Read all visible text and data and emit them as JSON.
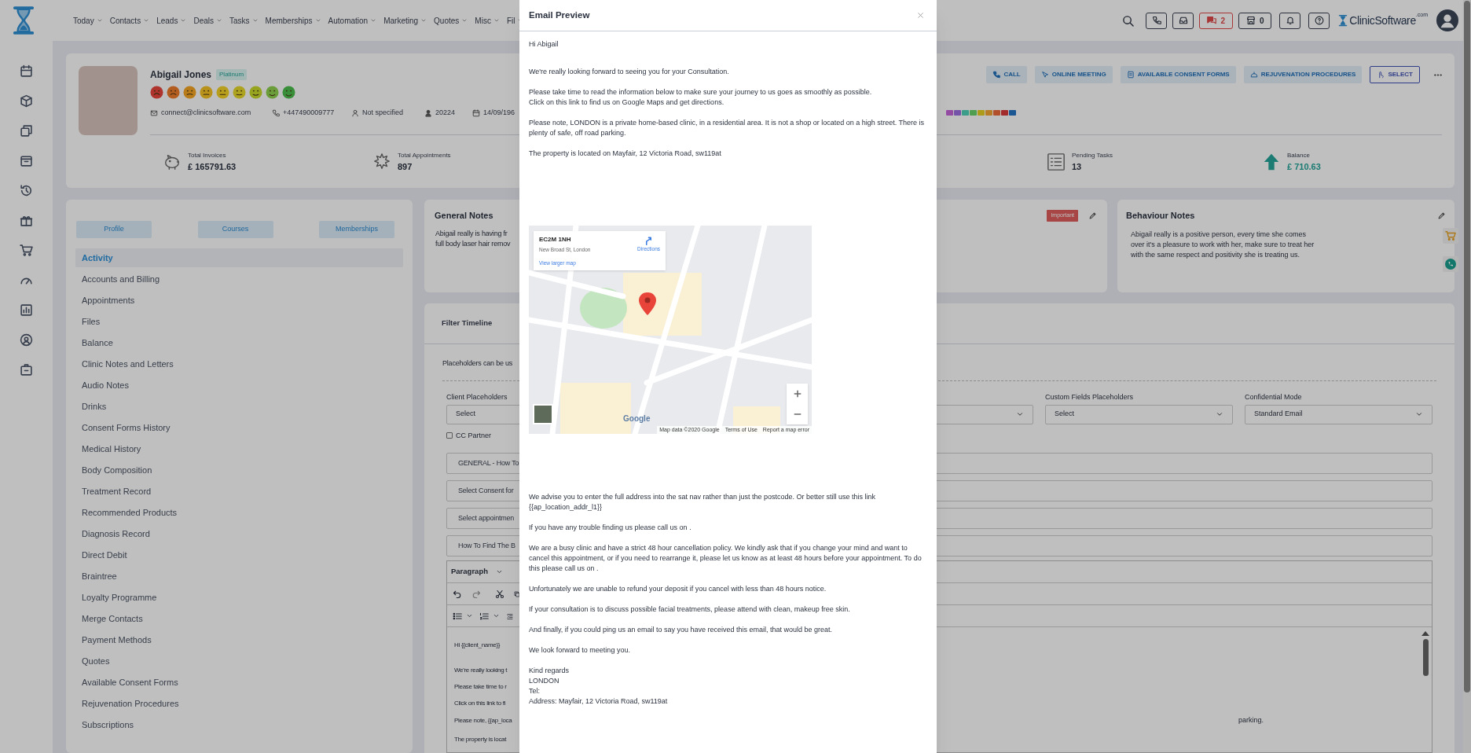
{
  "nav": {
    "items": [
      "Today",
      "Contacts",
      "Leads",
      "Deals",
      "Tasks",
      "Memberships",
      "Automation",
      "Marketing",
      "Quotes",
      "Misc",
      "Fil"
    ],
    "chat_count": "2",
    "store_count": "0",
    "brand": "ClinicSoftware",
    "brand_suffix": ".com"
  },
  "profile": {
    "name": "Abigail Jones",
    "tier": "Platinum",
    "ratings": [
      {
        "color": "#ae342d"
      },
      {
        "color": "#b45d20"
      },
      {
        "color": "#b87d1a"
      },
      {
        "color": "#b9921c"
      },
      {
        "color": "#b89e1d"
      },
      {
        "color": "#aea320"
      },
      {
        "color": "#97a420"
      },
      {
        "color": "#6b9d3b"
      },
      {
        "color": "#398f39"
      }
    ],
    "email": "connect@clinicsoftware.com",
    "phone": "+447490009777",
    "gender": "Not specified",
    "client_id": "20224",
    "birth_date": "14/09/196",
    "tags": [
      {
        "color": "#944ba2"
      },
      {
        "color": "#7453a8"
      },
      {
        "color": "#3b9d8a"
      },
      {
        "color": "#509e50"
      },
      {
        "color": "#af9b1a"
      },
      {
        "color": "#b67c26"
      },
      {
        "color": "#b3502c"
      },
      {
        "color": "#a22c2c"
      },
      {
        "color": "#1b5793"
      }
    ],
    "actions": [
      {
        "label": "CALL",
        "kind": "call"
      },
      {
        "label": "ONLINE MEETING",
        "kind": "meeting"
      },
      {
        "label": "AVAILABLE CONSENT FORMS",
        "kind": "forms"
      },
      {
        "label": "REJUVENATION PROCEDURES",
        "kind": "procedures"
      },
      {
        "label": "SELECT",
        "kind": "select"
      }
    ]
  },
  "stats": [
    {
      "kind": "invoices",
      "label": "Total Invoices",
      "value": "£ 165791.63"
    },
    {
      "kind": "appointments",
      "label": "Total Appointments",
      "value": "897"
    },
    {
      "kind": "tasks",
      "label": "Pending Tasks",
      "value": "13"
    },
    {
      "kind": "balance",
      "label": "Balance",
      "value": "£ 710.63"
    }
  ],
  "side_tabs": [
    "Profile",
    "Courses",
    "Memberships"
  ],
  "menu": [
    {
      "label": "Activity",
      "selected": true
    },
    {
      "label": "Accounts and Billing",
      "selected": false
    },
    {
      "label": "Appointments",
      "selected": false
    },
    {
      "label": "Files",
      "selected": false
    },
    {
      "label": "Balance",
      "selected": false
    },
    {
      "label": "Clinic Notes and Letters",
      "selected": false
    },
    {
      "label": "Audio Notes",
      "selected": false
    },
    {
      "label": "Drinks",
      "selected": false
    },
    {
      "label": "Consent Forms History",
      "selected": false
    },
    {
      "label": "Medical History",
      "selected": false
    },
    {
      "label": "Body Composition",
      "selected": false
    },
    {
      "label": "Treatment Record",
      "selected": false
    },
    {
      "label": "Recommended Products",
      "selected": false
    },
    {
      "label": "Diagnosis Record",
      "selected": false
    },
    {
      "label": "Direct Debit",
      "selected": false
    },
    {
      "label": "Braintree",
      "selected": false
    },
    {
      "label": "Loyalty Programme",
      "selected": false
    },
    {
      "label": "Merge Contacts",
      "selected": false
    },
    {
      "label": "Payment Methods",
      "selected": false
    },
    {
      "label": "Quotes",
      "selected": false
    },
    {
      "label": "Available Consent Forms",
      "selected": false
    },
    {
      "label": "Rejuvenation Procedures",
      "selected": false
    },
    {
      "label": "Subscriptions",
      "selected": false
    }
  ],
  "general_notes": {
    "title": "General Notes",
    "lines": [
      "Abigail really is having fr",
      "full body laser hair remov"
    ],
    "badge": "Important"
  },
  "behaviour_notes": {
    "title": "Behaviour Notes",
    "text": "Abigail really is a positive person, every time she comes over it's a pleasure to work with her, make sure to treat her with the same respect and positivity she is treating us."
  },
  "timeline": {
    "tab": "Filter Timeline",
    "hint": "Placeholders can be us",
    "selects": [
      {
        "label": "Client Placeholders",
        "value": "Select"
      },
      {
        "label": "Custom Fields Placeholders",
        "value": "Select"
      },
      {
        "label": "Confidential Mode",
        "value": "Standard Email"
      }
    ],
    "cc_partner": {
      "label": "CC Partner",
      "checked": false
    },
    "fields": [
      "GENERAL - How To",
      "Select Consent for",
      "Select appointmen",
      "How To Find The B"
    ],
    "editor": {
      "format": "Paragraph",
      "lines": [
        {
          "text": "Hi {{client_name}}"
        },
        {
          "text": "We're really looking t"
        },
        {
          "text": "Please take time to r"
        },
        {
          "text": "Click on this link to fi"
        },
        {
          "text": "Please note, {{ap_loca",
          "tail": "parking."
        },
        {
          "text": "The property is locat"
        }
      ]
    }
  },
  "modal": {
    "title": "Email Preview",
    "body": [
      {
        "kind": "text",
        "lines": [
          "Hi Abigail"
        ]
      },
      {
        "kind": "text",
        "lines": [
          "We're really looking forward to seeing you for your Consultation."
        ]
      },
      {
        "kind": "text",
        "lines": [
          "Please take time to read the information below to make sure your journey to us goes as smoothly as possible.",
          "Click on this link to find us on Google Maps and get directions."
        ]
      },
      {
        "kind": "text",
        "lines": [
          "Please note, LONDON is a private home-based clinic, in a residential area. It is not a shop or located on a high street. There is plenty of safe, off road parking."
        ]
      },
      {
        "kind": "text",
        "lines": [
          "The property is located on Mayfair, 12 Victoria Road, sw119at"
        ]
      },
      {
        "kind": "map",
        "postcode": "EC2M 1NH",
        "address": "New Broad St, London",
        "directions": "Directions",
        "larger": "View larger map",
        "logo": "Google",
        "attribution": [
          "Map data ©2020 Google",
          "Terms of Use",
          "Report a map error"
        ]
      },
      {
        "kind": "text",
        "lines": [
          "We advise you to enter the full address into the sat nav rather than just the postcode. Or better still use this link {{ap_location_addr_l1}}"
        ]
      },
      {
        "kind": "text",
        "lines": [
          "If you have any trouble finding us please call us on ."
        ]
      },
      {
        "kind": "text",
        "lines": [
          "We are a busy clinic and have a strict 48 hour cancellation policy. We kindly ask that if you change your mind and want to cancel this appointment, or if you need to rearrange it, please let us know as at least 48 hours before your appointment. To do this please call us on ."
        ]
      },
      {
        "kind": "text",
        "lines": [
          "Unfortunately we are unable to refund your deposit if you cancel with less than 48 hours notice."
        ]
      },
      {
        "kind": "text",
        "lines": [
          "If your consultation is to discuss possible facial treatments, please attend with clean, makeup free skin."
        ]
      },
      {
        "kind": "text",
        "lines": [
          "And finally, if you could ping us an email to say you have received this email, that would be great."
        ]
      },
      {
        "kind": "text",
        "lines": [
          "We look forward to meeting you."
        ]
      },
      {
        "kind": "text",
        "lines": [
          "Kind regards",
          "LONDON",
          "Tel:",
          "Address: Mayfair, 12 Victoria Road, sw119at"
        ]
      }
    ]
  }
}
